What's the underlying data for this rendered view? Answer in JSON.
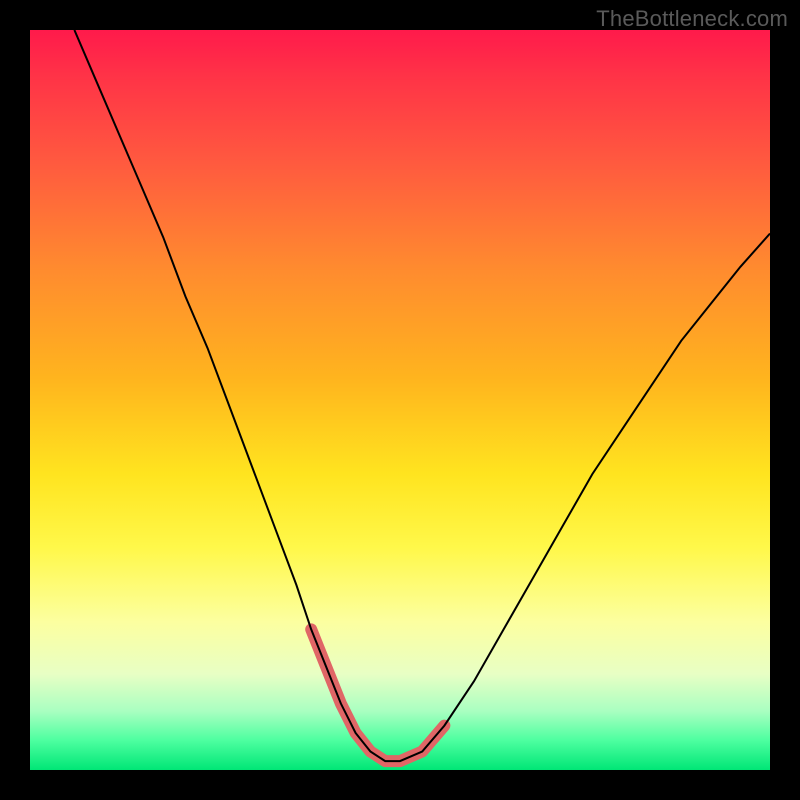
{
  "watermark": "TheBottleneck.com",
  "chart_data": {
    "type": "line",
    "title": "",
    "xlabel": "",
    "ylabel": "",
    "xlim": [
      0,
      100
    ],
    "ylim": [
      0,
      100
    ],
    "gradient_stops": [
      {
        "pos": 0,
        "color": "#ff1a4b"
      },
      {
        "pos": 6,
        "color": "#ff3247"
      },
      {
        "pos": 18,
        "color": "#ff5a3f"
      },
      {
        "pos": 32,
        "color": "#ff8a2f"
      },
      {
        "pos": 47,
        "color": "#ffb41e"
      },
      {
        "pos": 60,
        "color": "#ffe41f"
      },
      {
        "pos": 70,
        "color": "#fff84a"
      },
      {
        "pos": 80,
        "color": "#fcffa0"
      },
      {
        "pos": 87,
        "color": "#e8ffc4"
      },
      {
        "pos": 92,
        "color": "#aaffc1"
      },
      {
        "pos": 96,
        "color": "#4dffa0"
      },
      {
        "pos": 100,
        "color": "#00e676"
      }
    ],
    "series": [
      {
        "name": "bottleneck-curve",
        "stroke": "#000000",
        "stroke_width": 2,
        "x": [
          6,
          9,
          12,
          15,
          18,
          21,
          24,
          27,
          30,
          33,
          36,
          38,
          40,
          42,
          44,
          46,
          48,
          50,
          53,
          56,
          60,
          64,
          68,
          72,
          76,
          80,
          84,
          88,
          92,
          96,
          100
        ],
        "y": [
          100,
          93,
          86,
          79,
          72,
          64,
          57,
          49,
          41,
          33,
          25,
          19,
          14,
          9,
          5,
          2.5,
          1.2,
          1.2,
          2.5,
          6,
          12,
          19,
          26,
          33,
          40,
          46,
          52,
          58,
          63,
          68,
          72.5
        ]
      },
      {
        "name": "optimal-band",
        "stroke": "#e06666",
        "stroke_width": 12,
        "linecap": "round",
        "x": [
          38,
          40,
          42,
          44,
          46,
          48,
          50,
          53,
          56
        ],
        "y": [
          19,
          14,
          9,
          5,
          2.5,
          1.2,
          1.2,
          2.5,
          6
        ]
      }
    ]
  }
}
